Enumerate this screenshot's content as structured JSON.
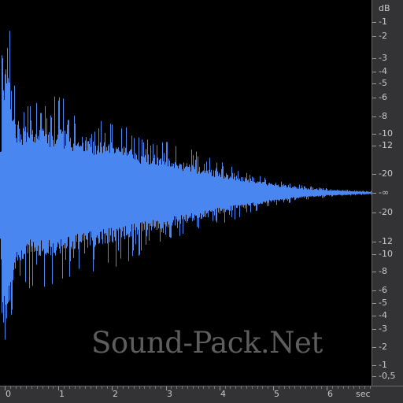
{
  "colors": {
    "background": "#000000",
    "waveform": "#4a86f0",
    "ruler_bg": "#333335",
    "ruler_text": "#c8c8c8",
    "watermark": "#5d5d5d"
  },
  "watermark": {
    "text": "Sound-Pack.Net"
  },
  "db_axis": {
    "unit": "dB",
    "labels_upper": [
      "-1",
      "-2",
      "-3",
      "-4",
      "-5",
      "-6",
      "-8",
      "-10",
      "-12",
      "-20"
    ],
    "center_label": "-∞",
    "labels_lower": [
      "-20",
      "-12",
      "-10",
      "-8",
      "-6",
      "-5",
      "-4",
      "-3",
      "-2",
      "-1",
      "-0,5"
    ]
  },
  "time_axis": {
    "labels": [
      "0",
      "1",
      "2",
      "3",
      "4",
      "5",
      "6"
    ],
    "unit": "sec"
  },
  "chart_data": {
    "type": "area",
    "x_unit": "sec",
    "x_range": [
      0,
      6.85
    ],
    "y_scale": "dB (symmetric waveform amplitude)",
    "envelope": {
      "x": [
        0,
        0.05,
        0.1,
        0.2,
        0.5,
        1.0,
        1.5,
        2.0,
        2.5,
        3.0,
        3.5,
        4.0,
        4.5,
        5.0,
        5.5,
        6.0,
        6.5,
        6.85
      ],
      "amplitude": [
        1.0,
        0.95,
        0.72,
        0.48,
        0.42,
        0.42,
        0.37,
        0.33,
        0.28,
        0.23,
        0.19,
        0.14,
        0.1,
        0.06,
        0.035,
        0.02,
        0.012,
        0.008
      ]
    },
    "grid": false
  }
}
